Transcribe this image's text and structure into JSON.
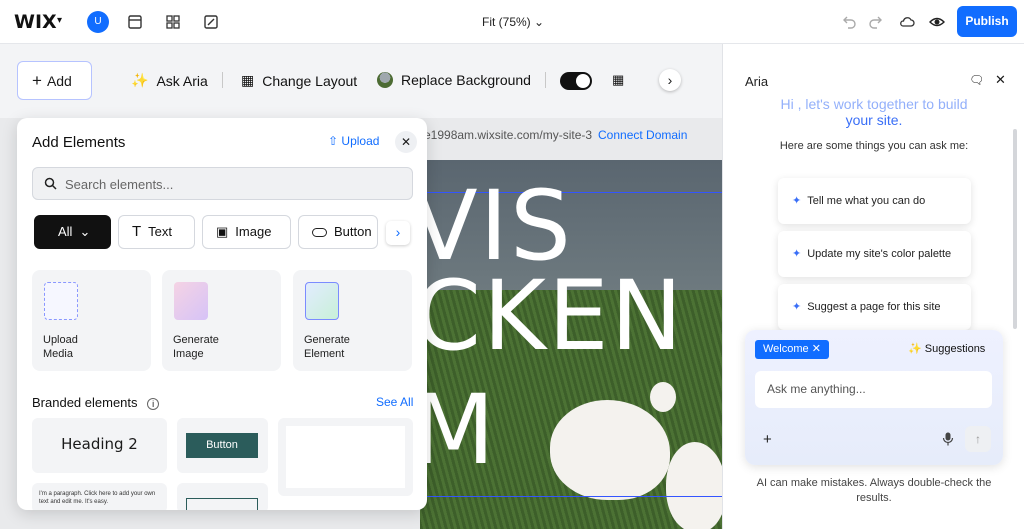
{
  "topbar": {
    "logo": "WIX",
    "avatar_letter": "U",
    "zoom": "Fit (75%)",
    "publish": "Publish"
  },
  "toolbar": {
    "add": "Add",
    "ask_aria": "Ask Aria",
    "change_layout": "Change Layout",
    "replace_background": "Replace Background"
  },
  "canvas": {
    "url": "e1998am.wixsite.com/my-site-3",
    "connect_domain": "Connect Domain",
    "hero_lines": [
      "VIS",
      "CKEN",
      "M"
    ]
  },
  "add_panel": {
    "title": "Add Elements",
    "upload": "Upload",
    "search_placeholder": "Search elements...",
    "filters": [
      "All",
      "Text",
      "Image",
      "Button"
    ],
    "cards": [
      {
        "line1": "Upload",
        "line2": "Media"
      },
      {
        "line1": "Generate",
        "line2": "Image"
      },
      {
        "line1": "Generate",
        "line2": "Element"
      }
    ],
    "branded_title": "Branded elements",
    "see_all": "See All",
    "heading_sample": "Heading 2",
    "button_sample": "Button",
    "paragraph_sample": "I'm a paragraph. Click here to add your own text and edit me. It's easy."
  },
  "aria": {
    "title": "Aria",
    "greeting_line1": "Hi , let's work together to build",
    "greeting_line2": "your site.",
    "hint": "Here are some things you can ask me:",
    "suggestions": [
      "Tell me what you can do",
      "Update my site's color palette",
      "Suggest a page for this site"
    ],
    "welcome_tag": "Welcome",
    "suggestions_button": "Suggestions",
    "input_placeholder": "Ask me anything...",
    "disclaimer": "AI can make mistakes. Always double-check the results."
  },
  "colors": {
    "accent": "#116dff",
    "aria_blue": "#3a6ff7"
  }
}
